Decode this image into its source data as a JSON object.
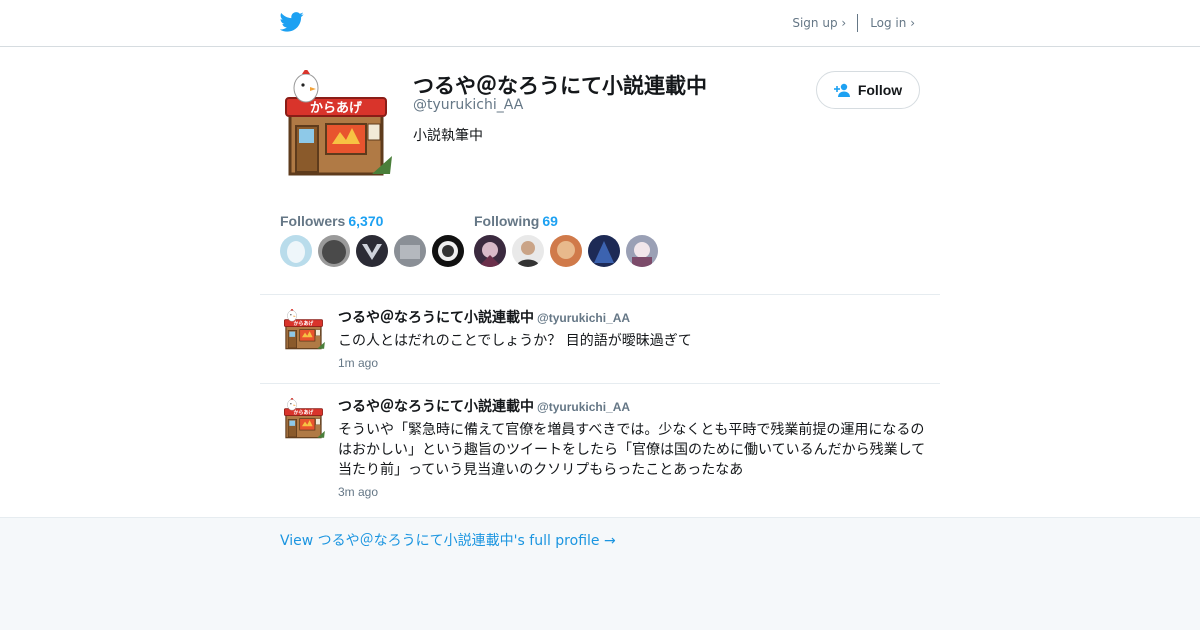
{
  "colors": {
    "accent": "#1da1f2",
    "link": "#1b95e0",
    "muted": "#657786",
    "text": "#14171a"
  },
  "topbar": {
    "logo_icon": "twitter-bird-icon",
    "signup_label": "Sign up ›",
    "login_label": "Log in ›"
  },
  "profile": {
    "name": "つるや＠なろうにて小説連載中",
    "handle": "@tyurukichi_AA",
    "bio": "小説執筆中",
    "follow_label": "Follow",
    "follow_icon": "add-user-icon"
  },
  "stats": {
    "followers_label": "Followers",
    "followers_count": "6,370",
    "following_label": "Following",
    "following_count": "69"
  },
  "tweets": [
    {
      "name": "つるや＠なろうにて小説連載中",
      "handle": "@tyurukichi_AA",
      "text": "この人とはだれのことでしょうか？ 目的語が曖昧過ぎて",
      "time": "1m ago"
    },
    {
      "name": "つるや＠なろうにて小説連載中",
      "handle": "@tyurukichi_AA",
      "text": "そういや「緊急時に備えて官僚を増員すべきでは。少なくとも平時で残業前提の運用になるのはおかしい」という趣旨のツイートをしたら「官僚は国のために働いているんだから残業して当たり前」っていう見当違いのクソリプもらったことあったなあ",
      "time": "3m ago"
    }
  ],
  "footer": {
    "link": "View つるや＠なろうにて小説連載中's full profile →"
  }
}
